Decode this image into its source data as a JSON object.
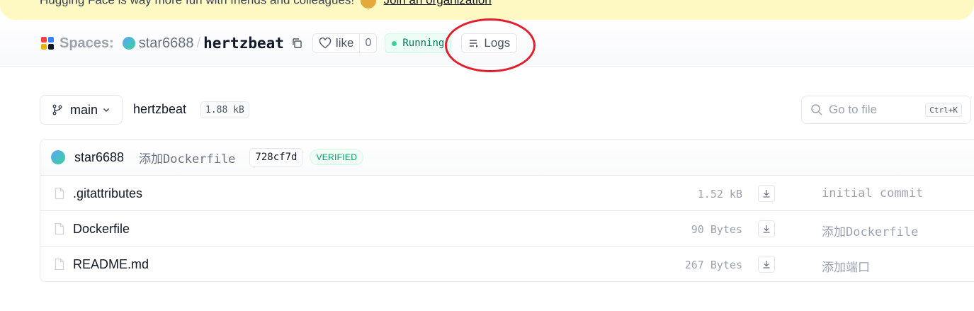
{
  "banner": {
    "text": "Hugging Face is way more fun with friends and colleagues!",
    "link": "Join an organization"
  },
  "header": {
    "spaces_label": "Spaces:",
    "owner": "star6688",
    "separator": "/",
    "repo": "hertzbeat",
    "like_label": "like",
    "like_count": "0",
    "status": "Running",
    "logs_label": "Logs"
  },
  "toolbar": {
    "branch": "main",
    "path": "hertzbeat",
    "size": "1.88 kB",
    "search_placeholder": "Go to file",
    "search_shortcut": "Ctrl+K"
  },
  "last_commit": {
    "author": "star6688",
    "message": "添加Dockerfile",
    "hash": "728cf7d",
    "badge": "VERIFIED"
  },
  "files": [
    {
      "name": ".gitattributes",
      "size": "1.52 kB",
      "commit": "initial commit"
    },
    {
      "name": "Dockerfile",
      "size": "90 Bytes",
      "commit": "添加Dockerfile"
    },
    {
      "name": "README.md",
      "size": "267 Bytes",
      "commit": "添加端口"
    }
  ],
  "colors": {
    "accent_green": "#047857",
    "annotation_red": "#e11d2e",
    "banner_yellow": "#fef9c3"
  },
  "icons": {
    "spaces_logo": "spaces-logo-icon",
    "copy": "copy-icon",
    "like": "heart-icon",
    "logs": "logs-icon",
    "branch": "git-branch-icon",
    "search": "search-icon",
    "file": "file-icon",
    "download": "download-icon"
  }
}
